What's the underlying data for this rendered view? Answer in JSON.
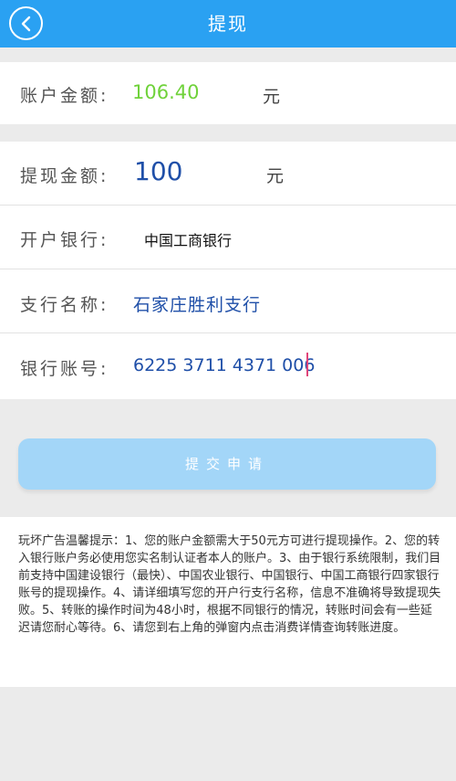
{
  "header": {
    "title": "提现",
    "back_icon": "chevron-left-icon"
  },
  "account": {
    "label": "账户金额:",
    "value": "106.40",
    "unit": "元"
  },
  "form": {
    "amount": {
      "label": "提现金额:",
      "value": "100",
      "unit": "元"
    },
    "bank": {
      "label": "开户银行:",
      "value": "中国工商银行"
    },
    "branch": {
      "label": "支行名称:",
      "value": "石家庄胜利支行"
    },
    "account_no": {
      "label": "银行账号:",
      "value": "6225 3711 4371 006"
    }
  },
  "submit": {
    "label": "提交申请"
  },
  "tips": {
    "text": "玩坏广告温馨提示：1、您的账户金额需大于50元方可进行提现操作。2、您的转入银行账户务必使用您实名制认证者本人的账户。3、由于银行系统限制，我们目前支持中国建设银行（最快）、中国农业银行、中国银行、中国工商银行四家银行账号的提现操作。4、请详细填写您的开户行支行名称，信息不准确将导致提现失败。5、转账的操作时间为48小时，根据不同银行的情况，转账时间会有一些延迟请您耐心等待。6、请您到右上角的弹窗内点击消费详情查询转账进度。"
  },
  "colors": {
    "header_bg": "#2aa1f2",
    "balance_green": "#6fd23a",
    "value_blue": "#1f4fa8",
    "button_bg": "#a3d6f8",
    "caret": "#e0457a"
  }
}
